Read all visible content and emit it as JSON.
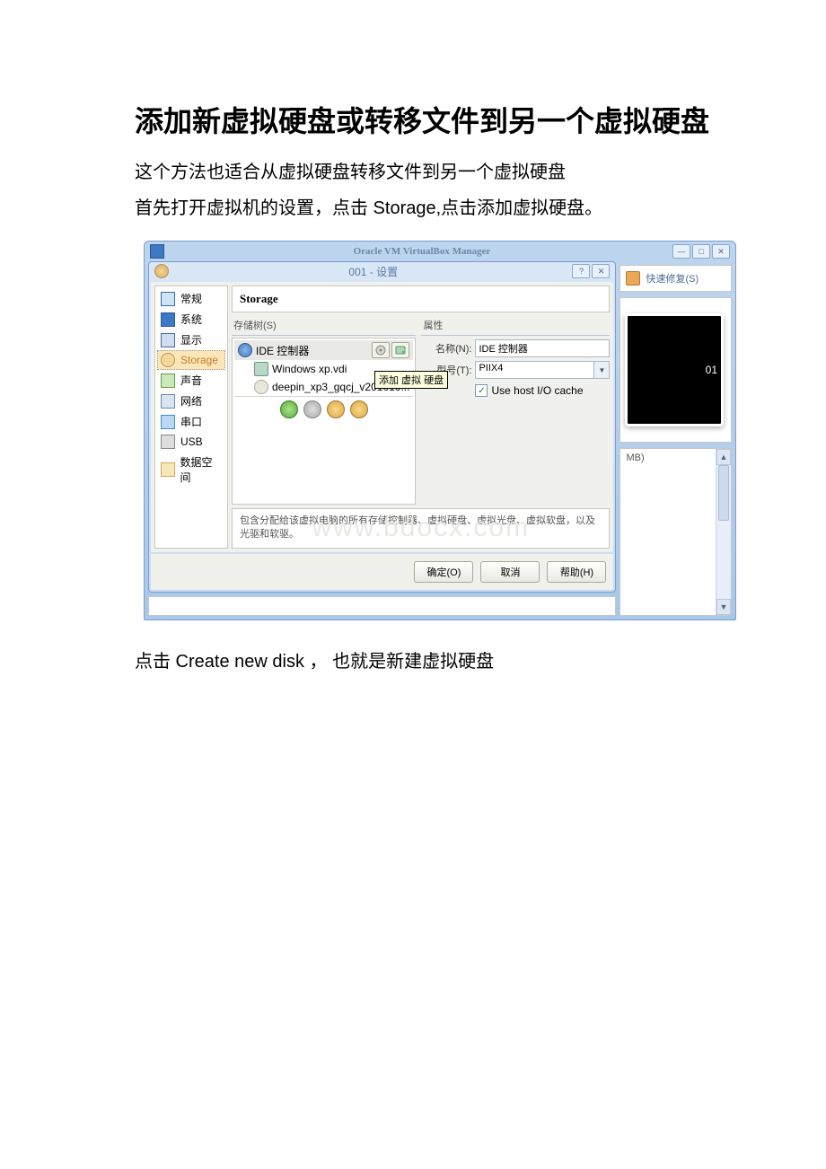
{
  "doc": {
    "title": "添加新虚拟硬盘或转移文件到另一个虚拟硬盘",
    "para1": "这个方法也适合从虚拟硬盘转移文件到另一个虚拟硬盘",
    "para2": "首先打开虚拟机的设置，点击 Storage,点击添加虚拟硬盘。",
    "para3": "点击 Create new disk ， 也就是新建虚拟硬盘"
  },
  "outer": {
    "title": "Oracle VM VirtualBox Manager",
    "preview_text": "01",
    "mb_text": "MB)"
  },
  "dialog": {
    "title": "001 - 设置",
    "panel_title": "Storage",
    "tree_header": "存储树(S)",
    "props_header": "属性",
    "controller": "IDE 控制器",
    "disk1": "Windows xp.vdi",
    "disk2": "deepin_xp3_gqcj_v201010...",
    "tooltip": "添加 虚拟 硬盘",
    "name_label": "名称(N):",
    "name_value": "IDE 控制器",
    "type_label": "型号(T):",
    "type_value": "PIIX4",
    "cache_label": "Use host I/O cache",
    "desc": "包含分配给该虚拟电脑的所有存储控制器、虚拟硬盘、虚拟光盘、虚拟软盘，以及光驱和软驱。",
    "watermark": "www.bdocx.com",
    "ok": "确定(O)",
    "cancel": "取消",
    "help": "帮助(H)"
  },
  "sidebar": {
    "items": [
      {
        "label": "常规"
      },
      {
        "label": "系统"
      },
      {
        "label": "显示"
      },
      {
        "label": "Storage"
      },
      {
        "label": "声音"
      },
      {
        "label": "网络"
      },
      {
        "label": "串口"
      },
      {
        "label": "USB"
      },
      {
        "label": "数据空间"
      }
    ]
  },
  "quickfix": {
    "label": "快速修复(S)"
  }
}
